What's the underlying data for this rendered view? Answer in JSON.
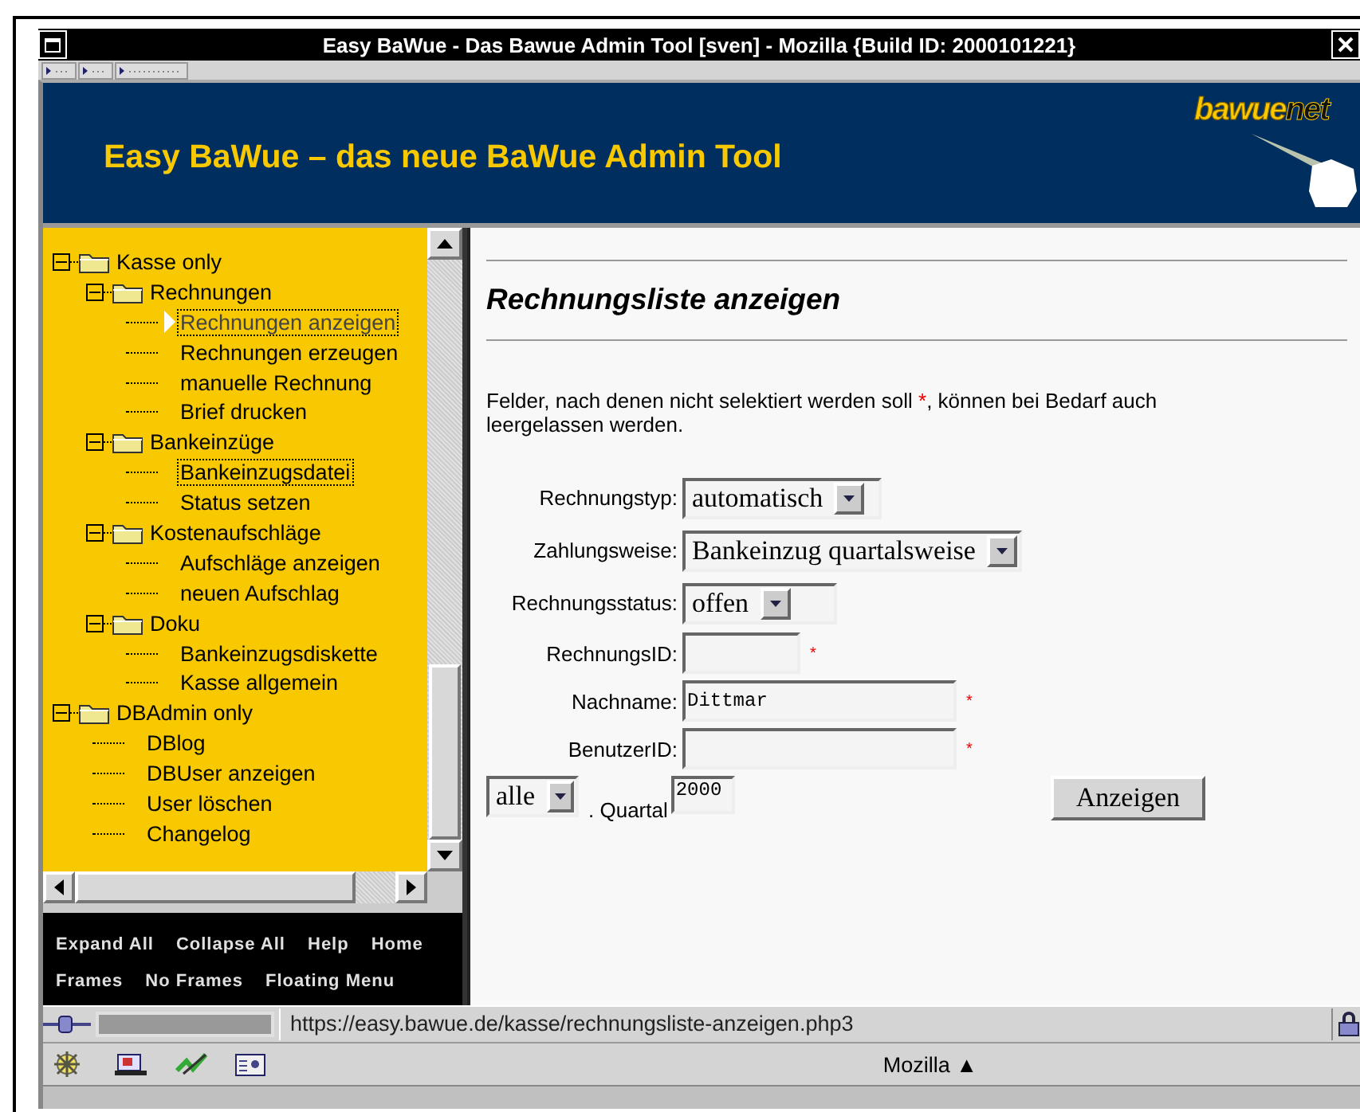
{
  "window": {
    "title": "Easy BaWue - Das Bawue Admin Tool [sven] - Mozilla {Build ID: 2000101221}"
  },
  "header": {
    "title": "Easy BaWue – das neue BaWue Admin Tool",
    "logo": [
      "bawue",
      "net"
    ]
  },
  "tree": [
    {
      "label": "Kasse only",
      "expanded": true,
      "children": [
        {
          "label": "Rechnungen",
          "expanded": true,
          "children": [
            {
              "label": "Rechnungen anzeigen",
              "selected": true,
              "outlined": true
            },
            {
              "label": "Rechnungen erzeugen",
              "selected": false,
              "outlined": false
            },
            {
              "label": "manuelle Rechnung",
              "selected": false,
              "outlined": false
            },
            {
              "label": "Brief drucken",
              "selected": false,
              "outlined": false
            }
          ]
        },
        {
          "label": "Bankeinzüge",
          "expanded": true,
          "children": [
            {
              "label": "Bankeinzugsdatei",
              "selected": false,
              "outlined": true
            },
            {
              "label": "Status setzen",
              "selected": false,
              "outlined": false
            }
          ]
        },
        {
          "label": "Kostenaufschläge",
          "expanded": true,
          "children": [
            {
              "label": "Aufschläge anzeigen",
              "selected": false,
              "outlined": false
            },
            {
              "label": "neuen Aufschlag",
              "selected": false,
              "outlined": false
            }
          ]
        },
        {
          "label": "Doku",
          "expanded": true,
          "children": [
            {
              "label": "Bankeinzugsdiskette",
              "selected": false,
              "outlined": false
            },
            {
              "label": "Kasse allgemein",
              "selected": false,
              "outlined": false
            }
          ]
        }
      ]
    },
    {
      "label": "DBAdmin only",
      "expanded": true,
      "children": [
        {
          "label": "DBlog",
          "selected": false,
          "outlined": false
        },
        {
          "label": "DBUser anzeigen",
          "selected": false,
          "outlined": false
        },
        {
          "label": "User löschen",
          "selected": false,
          "outlined": false
        },
        {
          "label": "Changelog",
          "selected": false,
          "outlined": false
        }
      ]
    }
  ],
  "nav_links": [
    [
      "Expand All",
      "Collapse All",
      "Help",
      "Home"
    ],
    [
      "Frames",
      "No Frames",
      "Floating Menu"
    ]
  ],
  "content": {
    "title": "Rechnungsliste anzeigen",
    "note": {
      "before": "Felder, nach denen nicht selektiert werden soll ",
      "mark": "*",
      "after": ", können bei Bedarf auch leergelassen werden."
    },
    "rows": [
      {
        "label": "Rechnungstyp:",
        "kind": "select",
        "value": "automatisch"
      },
      {
        "label": "Zahlungsweise:",
        "kind": "select",
        "value": "Bankeinzug quartalsweise"
      },
      {
        "label": "Rechnungsstatus:",
        "kind": "select",
        "value": "offen"
      },
      {
        "label": "RechnungsID:",
        "kind": "text",
        "required_mark": "*"
      },
      {
        "label": "Nachname:",
        "kind": "text",
        "value": "Dittmar",
        "required_mark": "*"
      },
      {
        "label": "BenutzerID:",
        "kind": "text",
        "required_mark": "*"
      }
    ],
    "quarter_select": "alle",
    "quarter_label": ". Quartal",
    "year": "2000",
    "submit": "Anzeigen"
  },
  "status_bar": {
    "url": "https://easy.bawue.de/kasse/rechnungsliste-anzeigen.php3"
  },
  "taskbar": {
    "label": "Mozilla ▲"
  }
}
